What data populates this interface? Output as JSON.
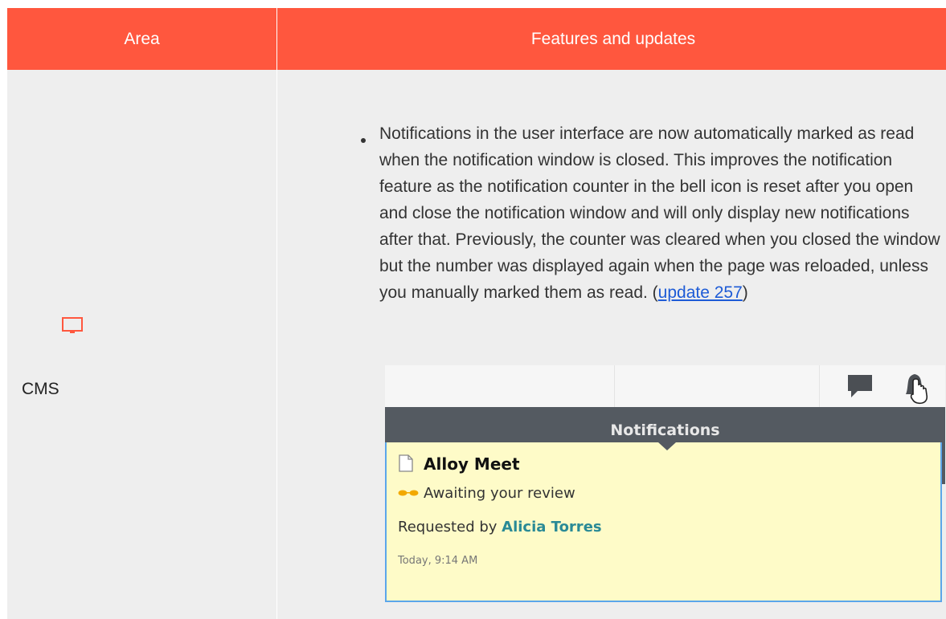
{
  "table": {
    "header_area": "Area",
    "header_features": "Features and updates"
  },
  "row": {
    "area_label": "CMS",
    "area_icon": "monitor-icon",
    "text_before_link": "Notifications in the user interface are now automatically marked as read when the notification window is closed. This improves the notification feature as the notification counter in the bell icon is reset after you open and close the notification window and will only display new notifications after that. Previously, the counter was cleared when you closed the window but the number was displayed again when the page was reloaded, unless you manually marked them as read. (",
    "link_text": "update 257",
    "text_after_link": ")"
  },
  "screenshot": {
    "panel_title": "Notifications",
    "item_title": "Alloy Meet",
    "status": "Awaiting your review",
    "requested_prefix": "Requested by",
    "requested_by": "Alicia Torres",
    "time": "Today, 9:14 AM",
    "icons": [
      "chat-icon",
      "bell-icon",
      "document-icon",
      "glasses-icon"
    ]
  },
  "colors": {
    "header_bg": "#ff573e",
    "body_bg": "#eeeeee",
    "link": "#1d5bd6",
    "accent_icon": "#ff573e",
    "notification_bg": "#fefbc8",
    "notification_border": "#5ba6ea",
    "panel_dark": "#545a61",
    "requester": "#2a8a96"
  }
}
